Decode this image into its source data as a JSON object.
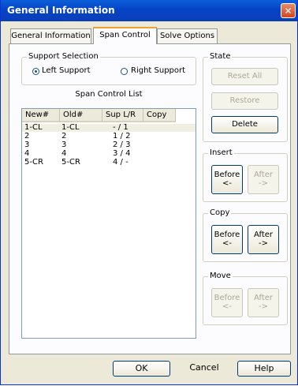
{
  "window": {
    "title": "General Information",
    "close_glyph": "✕"
  },
  "tabs": [
    {
      "label": "General Information",
      "active": false
    },
    {
      "label": "Span Control",
      "active": true
    },
    {
      "label": "Solve Options",
      "active": false
    }
  ],
  "support_selection": {
    "title": "Support Selection",
    "left_label": "Left Support",
    "right_label": "Right Support",
    "selected": "left"
  },
  "span_control_list": {
    "title": "Span Control List",
    "columns": [
      "New#",
      "Old#",
      "Sup L/R",
      "Copy"
    ],
    "rows": [
      {
        "new": "1-CL",
        "old": "1-CL",
        "sup": "- / 1",
        "copy": "",
        "selected": true
      },
      {
        "new": "2",
        "old": "2",
        "sup": "1 / 2",
        "copy": "",
        "selected": false
      },
      {
        "new": "3",
        "old": "3",
        "sup": "2 / 3",
        "copy": "",
        "selected": false
      },
      {
        "new": "4",
        "old": "4",
        "sup": "3 / 4",
        "copy": "",
        "selected": false
      },
      {
        "new": "5-CR",
        "old": "5-CR",
        "sup": "4 / -",
        "copy": "",
        "selected": false
      }
    ]
  },
  "state": {
    "title": "State",
    "reset_all": "Reset All",
    "restore": "Restore",
    "delete": "Delete"
  },
  "insert": {
    "title": "Insert",
    "before": "Before",
    "before_arrow": "<-",
    "after": "After",
    "after_arrow": "->"
  },
  "copy": {
    "title": "Copy",
    "before": "Before",
    "before_arrow": "<-",
    "after": "After",
    "after_arrow": "->"
  },
  "move": {
    "title": "Move",
    "before": "Before",
    "before_arrow": "<-",
    "after": "After",
    "after_arrow": "->"
  },
  "footer": {
    "ok": "OK",
    "cancel": "Cancel",
    "help": "Help"
  }
}
